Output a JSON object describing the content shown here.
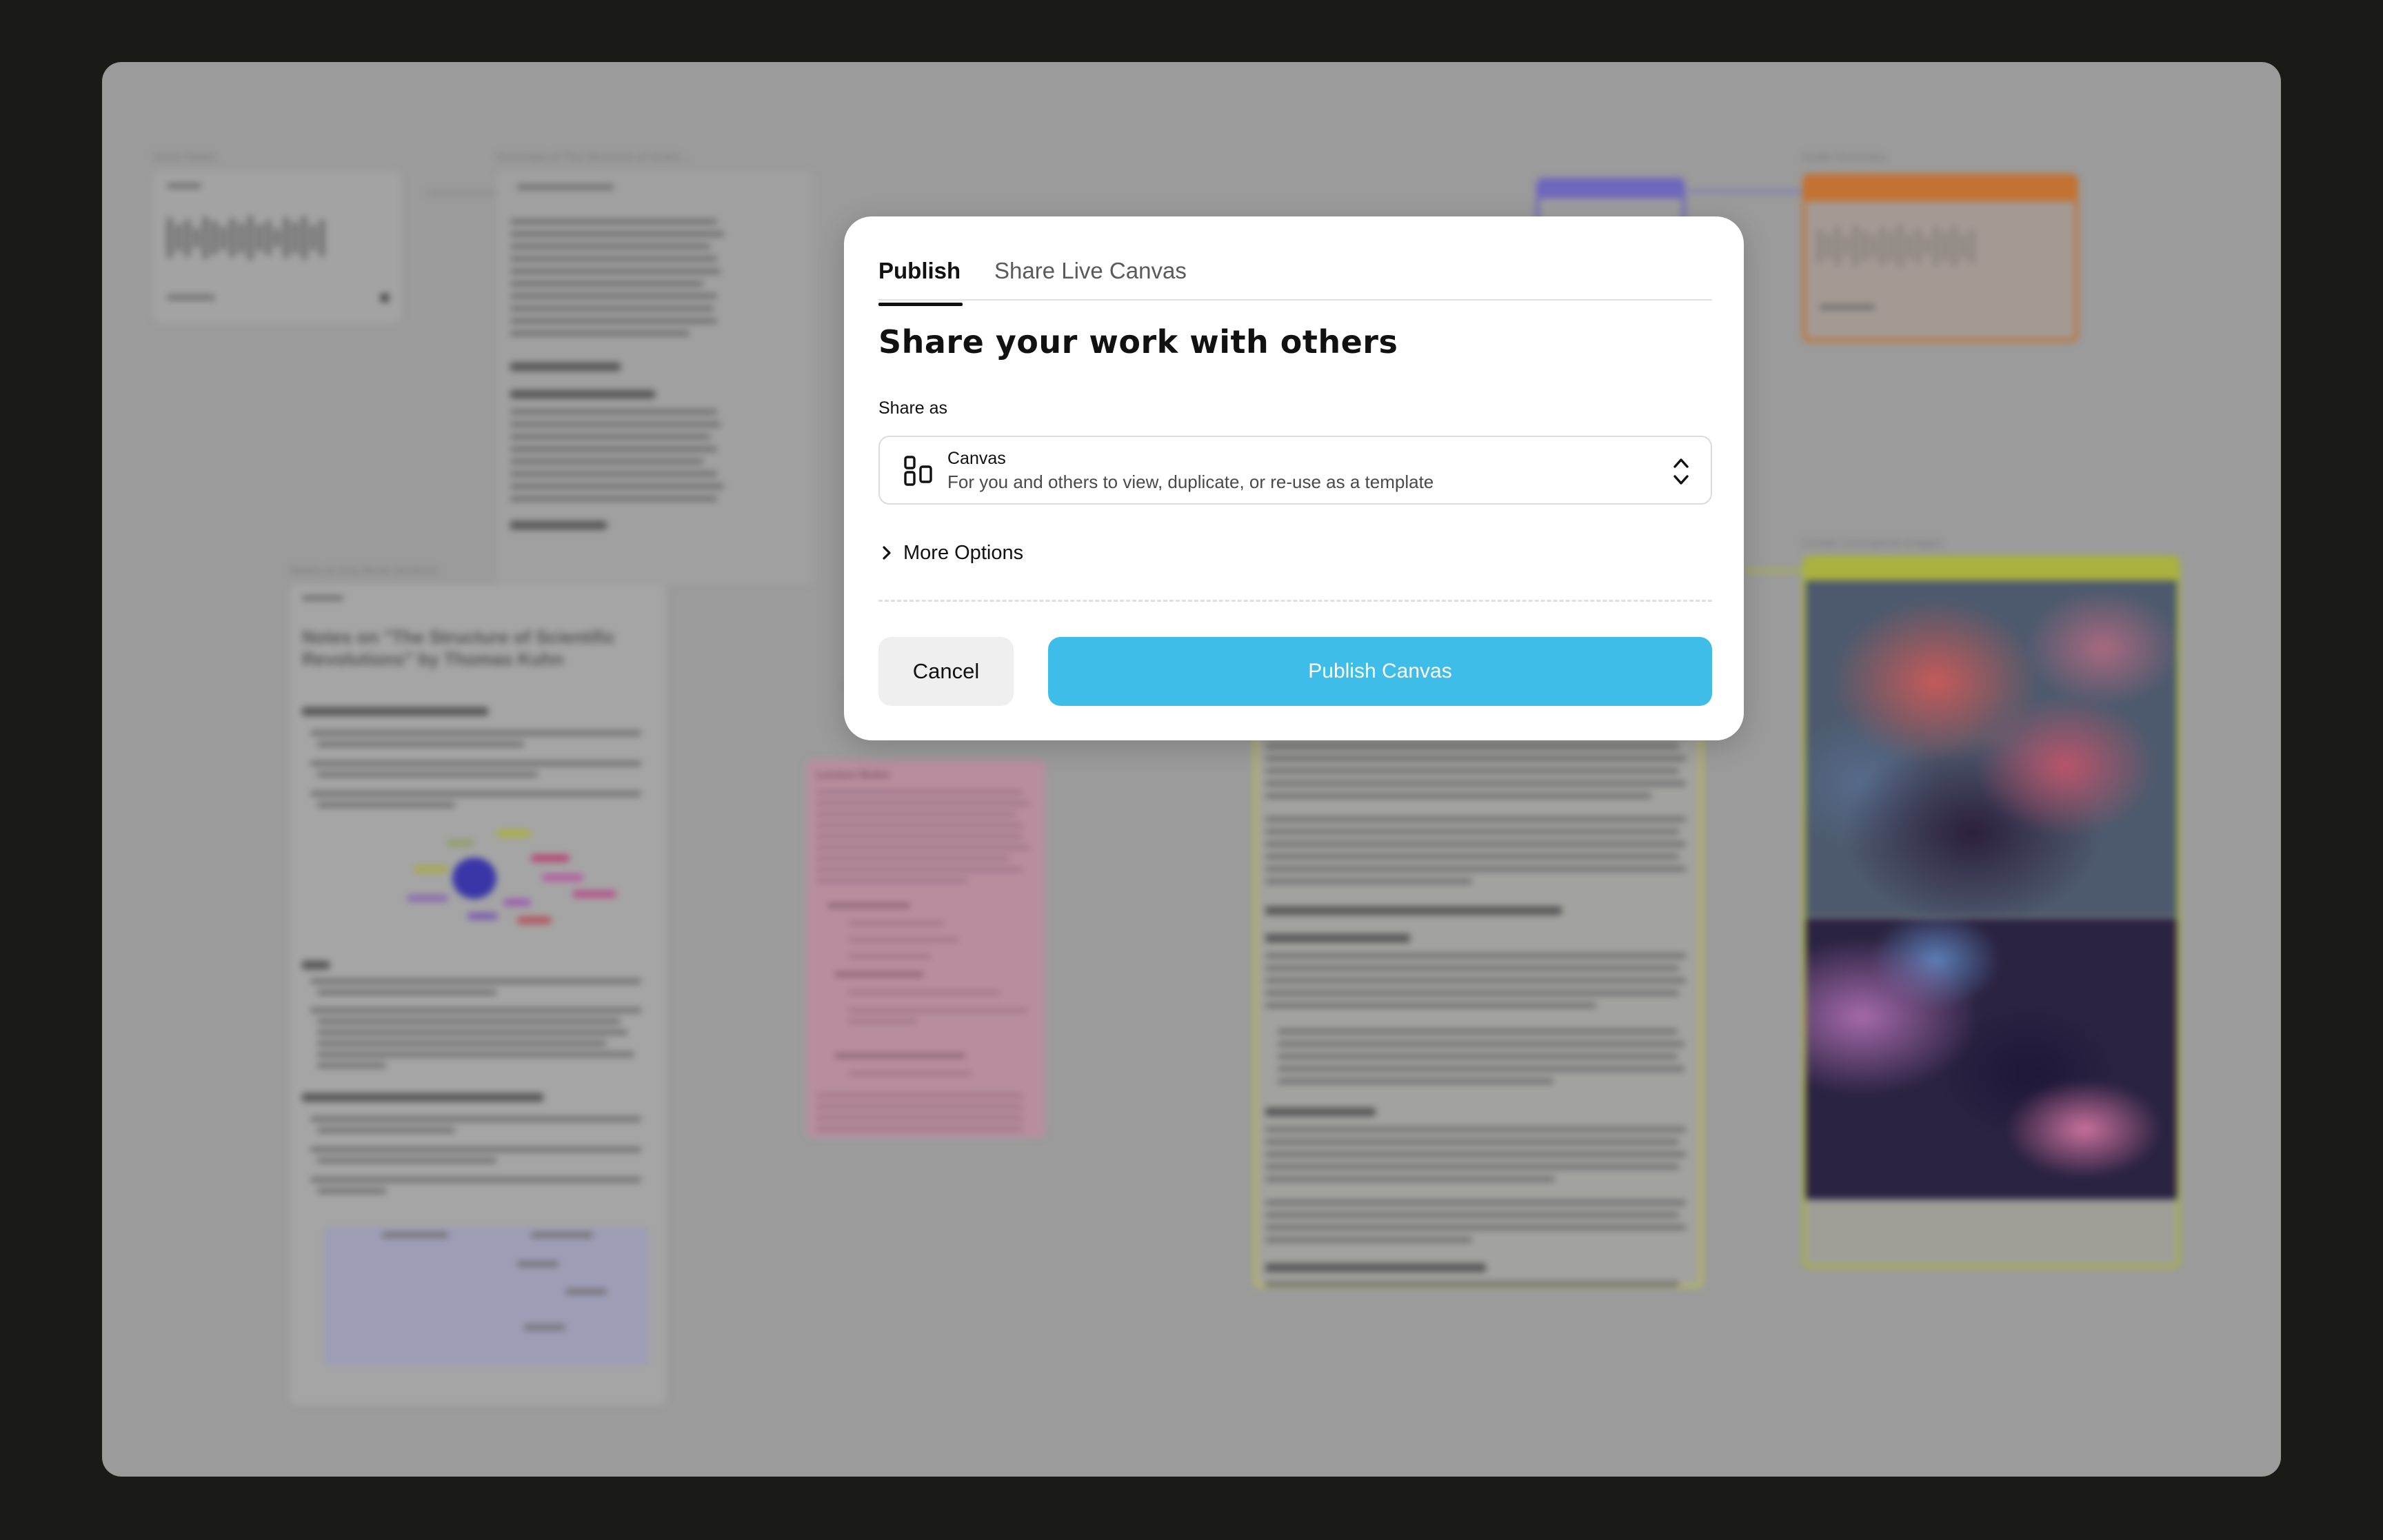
{
  "modal": {
    "tabs": [
      {
        "label": "Publish",
        "active": true
      },
      {
        "label": "Share Live Canvas",
        "active": false
      }
    ],
    "heading": "Share your work with others",
    "share_as_label": "Share as",
    "share_option": {
      "title": "Canvas",
      "subtitle": "For you and others to view, duplicate, or re-use as a template",
      "icon": "canvas-layout-icon"
    },
    "more_options_label": "More Options",
    "cancel_label": "Cancel",
    "publish_label": "Publish Canvas"
  },
  "background_canvas": {
    "state": "blurred",
    "node_titles": [
      "Voice Notes",
      "Summary of The Structure of Scien...",
      "Audio Summary",
      "Notes on Key Book Sections",
      "Create Conceptual Images"
    ],
    "document_heading": "Notes on \"The Structure of Scientific Revolutions\" by Thomas Kuhn",
    "lecture_notes_title": "Lecture Notes"
  },
  "colors": {
    "publish_button": "#3ebde9",
    "page_background": "#1a1a16",
    "overlay": "#9b9b9b"
  }
}
